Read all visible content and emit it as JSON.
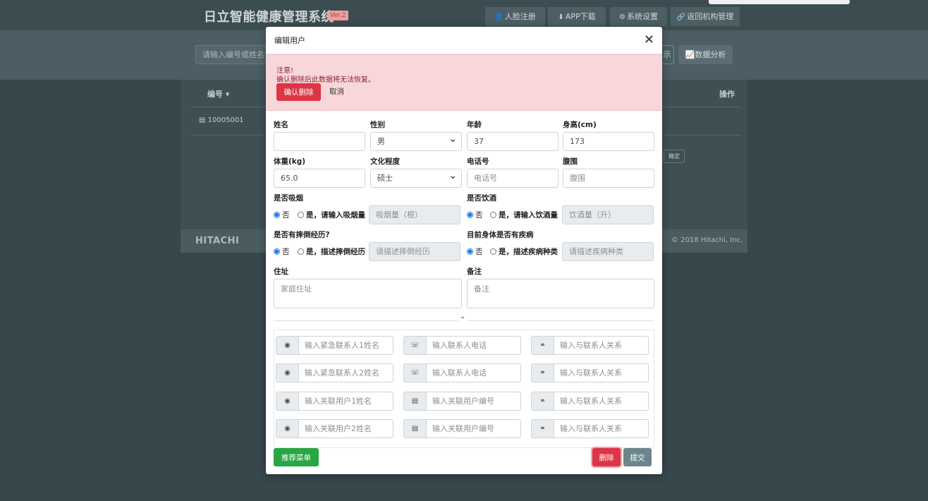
{
  "app": {
    "title": "日立智能健康管理系统",
    "version": "Ver.2"
  },
  "nav": [
    {
      "label": "人脸注册",
      "icon": "user-icon",
      "glyph": "👤"
    },
    {
      "label": "APP下载",
      "icon": "download-icon",
      "glyph": "⬇"
    },
    {
      "label": "系统设置",
      "icon": "gear-icon",
      "glyph": "⚙"
    },
    {
      "label": "返回机构管理",
      "icon": "link-icon",
      "glyph": "🔗"
    }
  ],
  "background": {
    "search_placeholder": "请输入编号或姓名",
    "partial_button": "示",
    "data_analysis": "数据分析",
    "col_id": "编号",
    "col_op": "操作",
    "row_id": "10005001",
    "ok_button": "确定",
    "footer_logo": "HITACHI",
    "footer_copy": "© 2018 Hitachi, Inc."
  },
  "modal": {
    "title": "编辑用户",
    "close": "×",
    "alert": {
      "title": "注意!",
      "text": "确认删除后此数据将无法恢复。",
      "confirm": "确认删除",
      "cancel": "取消"
    },
    "fields": {
      "name": {
        "label": "姓名",
        "value": ""
      },
      "gender": {
        "label": "性别",
        "value": "男"
      },
      "age": {
        "label": "年龄",
        "value": "37"
      },
      "height": {
        "label": "身高(cm)",
        "value": "173"
      },
      "weight": {
        "label": "体重(kg)",
        "value": "65.0"
      },
      "education": {
        "label": "文化程度",
        "value": "硕士"
      },
      "phone": {
        "label": "电话号",
        "placeholder": "电话号"
      },
      "waist": {
        "label": "腹围",
        "placeholder": "腹围"
      },
      "smoking": {
        "label": "是否吸烟",
        "no": "否",
        "yes": "是，请输入吸烟量",
        "placeholder": "吸烟量（根）",
        "selected": "no"
      },
      "drinking": {
        "label": "是否饮酒",
        "no": "否",
        "yes": "是，请输入饮酒量",
        "placeholder": "饮酒量（升）",
        "selected": "no"
      },
      "fall": {
        "label": "是否有摔倒经历?",
        "no": "否",
        "yes": "是，描述摔倒经历",
        "placeholder": "请描述摔倒经历",
        "selected": "no"
      },
      "disease": {
        "label": "目前身体是否有疾病",
        "no": "否",
        "yes": "是，描述疾病种类",
        "placeholder": "请描述疾病种类",
        "selected": "no"
      },
      "address": {
        "label": "住址",
        "placeholder": "家庭住址"
      },
      "remark": {
        "label": "备注",
        "placeholder": "备注"
      }
    },
    "collapse": "⌃",
    "contacts": [
      [
        {
          "icon": "user-circle-icon",
          "glyph": "◉",
          "placeholder": "输入紧急联系人1姓名"
        },
        {
          "icon": "phone-icon",
          "glyph": "☏",
          "placeholder": "输入联系人电话"
        },
        {
          "icon": "handshake-icon",
          "glyph": "⚭",
          "placeholder": "输入与联系人关系"
        }
      ],
      [
        {
          "icon": "user-circle-icon",
          "glyph": "◉",
          "placeholder": "输入紧急联系人2姓名"
        },
        {
          "icon": "phone-icon",
          "glyph": "☏",
          "placeholder": "输入联系人电话"
        },
        {
          "icon": "handshake-icon",
          "glyph": "⚭",
          "placeholder": "输入与联系人关系"
        }
      ],
      [
        {
          "icon": "user-circle-icon",
          "glyph": "◉",
          "placeholder": "输入关联用户1姓名"
        },
        {
          "icon": "id-card-icon",
          "glyph": "▤",
          "placeholder": "输入关联用户编号"
        },
        {
          "icon": "handshake-icon",
          "glyph": "⚭",
          "placeholder": "输入与联系人关系"
        }
      ],
      [
        {
          "icon": "user-circle-icon",
          "glyph": "◉",
          "placeholder": "输入关联用户2姓名"
        },
        {
          "icon": "id-card-icon",
          "glyph": "▤",
          "placeholder": "输入关联用户编号"
        },
        {
          "icon": "handshake-icon",
          "glyph": "⚭",
          "placeholder": "输入与联系人关系"
        }
      ]
    ],
    "buttons": {
      "recommend": "推荐菜单",
      "delete": "删除",
      "submit": "提交"
    }
  }
}
